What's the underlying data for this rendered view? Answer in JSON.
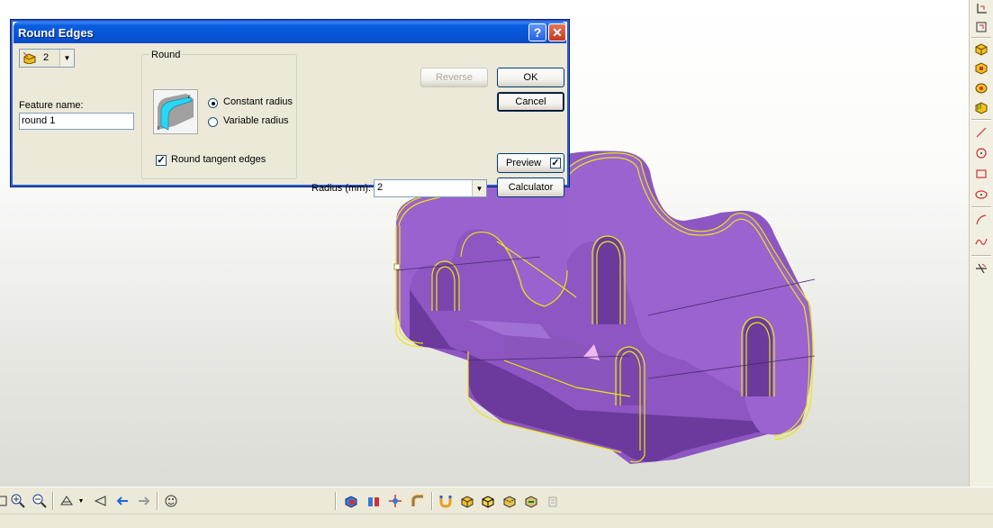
{
  "dialog": {
    "title": "Round Edges",
    "edge_count": "2",
    "feature_name_label": "Feature name:",
    "feature_name_value": "round 1",
    "round_group_label": "Round",
    "constant_radius_label": "Constant radius",
    "variable_radius_label": "Variable radius",
    "selected_mode": "Constant radius",
    "round_tangent_edges_label": "Round tangent edges",
    "round_tangent_edges_checked": true,
    "radius_label": "Radius (mm):",
    "radius_value": "2",
    "reverse_label": "Reverse",
    "ok_label": "OK",
    "cancel_label": "Cancel",
    "preview_label": "Preview",
    "preview_checked": true,
    "calculator_label": "Calculator",
    "help_icon": "question-mark-icon",
    "close_icon": "close-x-icon"
  },
  "right_toolbar": {
    "icons": [
      "sketch-plane-icon",
      "sketch-edit-icon",
      "extrude-icon",
      "extrude-cut-icon",
      "revolve-icon",
      "shell-icon",
      "line-icon",
      "circle-icon",
      "rectangle-icon",
      "ellipse-icon",
      "arc-icon",
      "spline-icon",
      "trim-icon"
    ]
  },
  "bottom_toolbar": {
    "icons": [
      "pan-icon",
      "zoom-in-icon",
      "zoom-out-icon",
      "view-orientation-icon",
      "view-dropdown-icon",
      "previous-view-icon",
      "back-arrow-icon",
      "forward-arrow-icon",
      "face-icon",
      "combine-icon",
      "split-icon",
      "move-icon",
      "pipe-icon",
      "magnet-icon",
      "shaded-cube-icon",
      "shaded-cube-edges-icon",
      "hidden-lines-icon",
      "wireframe-cube-icon",
      "ghost-icon"
    ]
  },
  "colors": {
    "model_face": "#9b63d0",
    "model_dark": "#5a2f86",
    "model_shadow": "#1c1c1c",
    "selection_edge": "#e8e80f",
    "titlebar": "#0754d6"
  }
}
